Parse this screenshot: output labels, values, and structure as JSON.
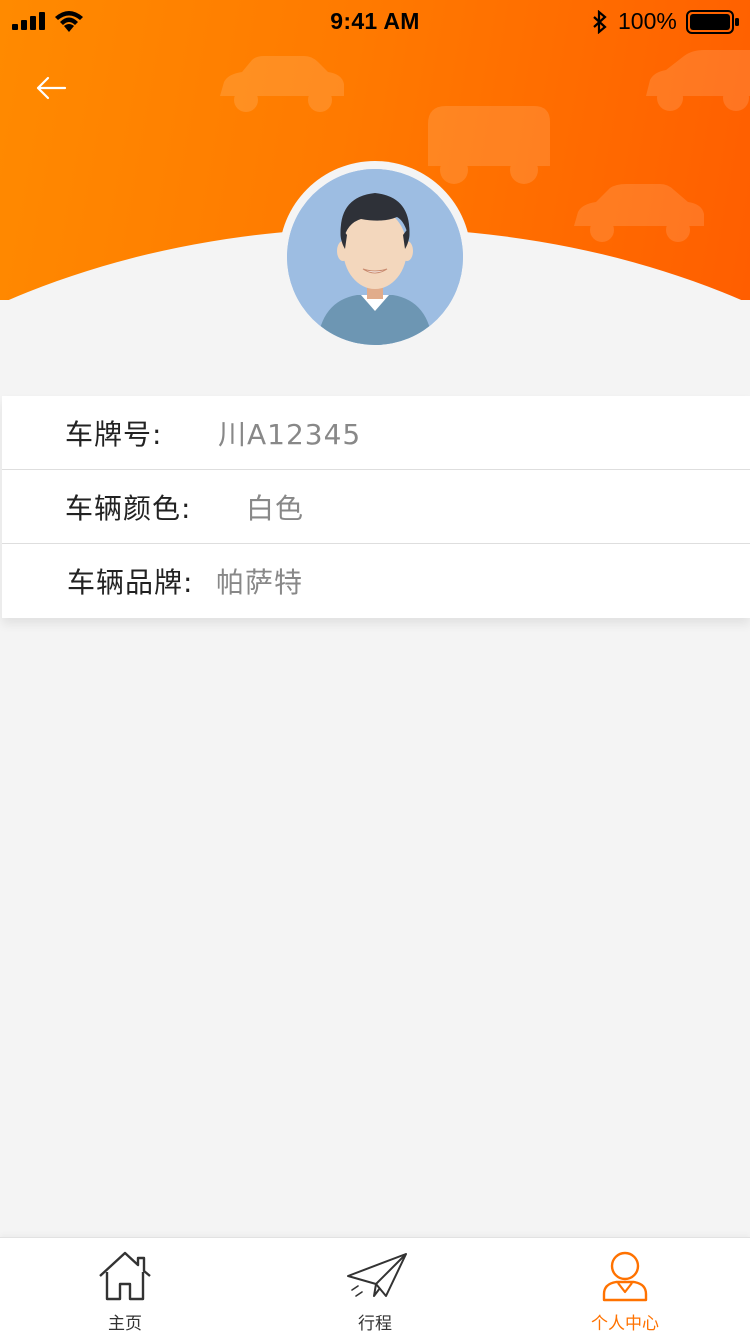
{
  "status_bar": {
    "time": "9:41 AM",
    "battery": "100%",
    "icons": [
      "signal-icon",
      "wifi-icon",
      "bluetooth-icon",
      "battery-icon"
    ]
  },
  "header": {
    "back_icon": "arrow-left-icon",
    "avatar": "user-avatar"
  },
  "vehicle_info": [
    {
      "label": "车牌号:",
      "value": "川A12345"
    },
    {
      "label": "车辆颜色:",
      "value": "白色"
    },
    {
      "label": "车辆品牌:",
      "value": "帕萨特"
    }
  ],
  "tabbar": {
    "items": [
      {
        "label": "主页",
        "icon": "home-icon",
        "active": false
      },
      {
        "label": "行程",
        "icon": "paper-plane-icon",
        "active": false
      },
      {
        "label": "个人中心",
        "icon": "person-icon",
        "active": true
      }
    ]
  },
  "colors": {
    "accent": "#ff7200",
    "header_start": "#ff8a00",
    "header_end": "#ff5e00",
    "background": "#f4f4f4"
  }
}
